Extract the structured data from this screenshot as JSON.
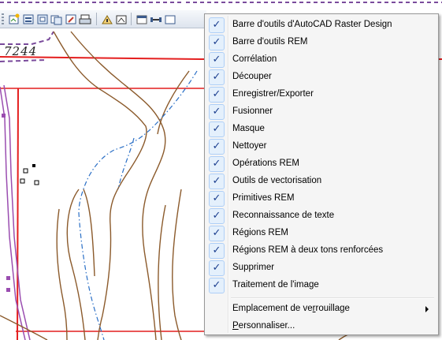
{
  "drawing": {
    "label_number": "7244"
  },
  "toolbar": {
    "buttons": [
      {
        "icon": "insert-image-icon"
      },
      {
        "icon": "image-manager-icon"
      },
      {
        "icon": "image-frame-icon"
      },
      {
        "icon": "image-copy-icon"
      },
      {
        "icon": "image-edit-icon"
      },
      {
        "icon": "image-print-icon"
      },
      {
        "icon": "image-insert-alt-icon"
      },
      {
        "icon": "image-crop-icon"
      },
      {
        "icon": "measure-icon"
      },
      {
        "icon": "partial-next-icon"
      }
    ]
  },
  "menu": {
    "items": [
      {
        "label": "Barre d'outils d'AutoCAD Raster Design",
        "checked": true
      },
      {
        "label": "Barre d'outils REM",
        "checked": true
      },
      {
        "label": "Corrélation",
        "checked": true
      },
      {
        "label": "Découper",
        "checked": true
      },
      {
        "label": "Enregistrer/Exporter",
        "checked": true
      },
      {
        "label": "Fusionner",
        "checked": true
      },
      {
        "label": "Masque",
        "checked": true
      },
      {
        "label": "Nettoyer",
        "checked": true
      },
      {
        "label": "Opérations REM",
        "checked": true
      },
      {
        "label": "Outils de vectorisation",
        "checked": true
      },
      {
        "label": "Primitives REM",
        "checked": true
      },
      {
        "label": "Reconnaissance de texte",
        "checked": true
      },
      {
        "label": "Régions REM",
        "checked": true
      },
      {
        "label": "Régions REM à deux tons renforcées",
        "checked": true
      },
      {
        "label": "Supprimer",
        "checked": true
      },
      {
        "label": "Traitement de l'image",
        "checked": true
      }
    ],
    "lock_location": {
      "prefix": "Emplacement de ve",
      "mnemonic": "r",
      "suffix": "rouillage"
    },
    "customize": {
      "prefix": "",
      "mnemonic": "P",
      "suffix": "ersonnaliser..."
    },
    "check_glyph": "✓"
  }
}
